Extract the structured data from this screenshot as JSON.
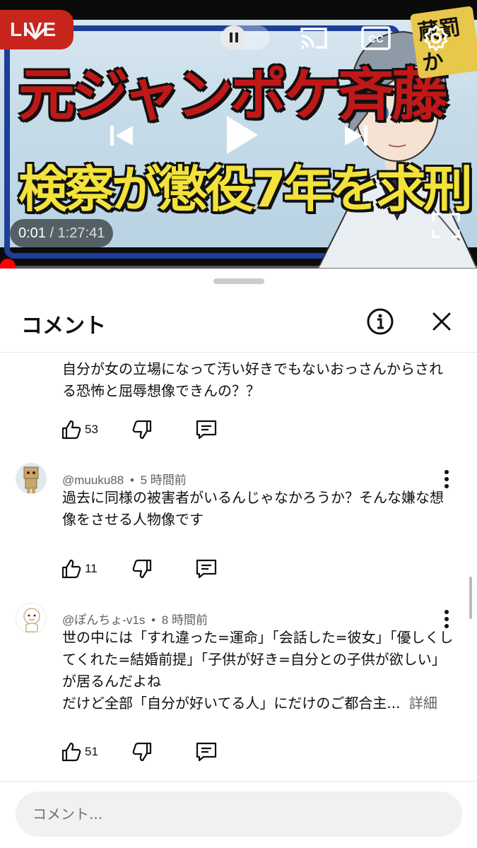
{
  "player": {
    "badge": "LIVE",
    "corner_tag": "蔵罰か",
    "title_line1": "元ジャンポケ斉藤",
    "title_line2": "検察が懲役7年を求刑",
    "time_current": "0:01",
    "time_separator": " / ",
    "time_total": "1:27:41",
    "progress": 0.0002,
    "icons": [
      "chevron-down-icon",
      "pause-icon",
      "cast-icon",
      "captions-icon",
      "settings-icon",
      "previous-icon",
      "play-icon",
      "next-icon",
      "fullscreen-icon"
    ],
    "colors": {
      "accent": "#ff0000",
      "live": "#c8261d"
    }
  },
  "sheet": {
    "title": "コメント",
    "input_placeholder": "コメント..."
  },
  "comments": [
    {
      "author": "",
      "time": "",
      "text": "自分が女の立場になって汚い好きでもないおっさんからされる恐怖と屈辱想像できんの？？",
      "more": "",
      "likes": "53"
    },
    {
      "author": "@muuku88",
      "dot": "•",
      "time": "5 時間前",
      "text": "過去に同様の被害者がいるんじゃなかろうか？そんな嫌な想像をさせる人物像です",
      "more": "",
      "likes": "11"
    },
    {
      "author": "@ぽんちょ-v1s",
      "dot": "•",
      "time": "8 時間前",
      "text_lines": [
        "世の中には「すれ違った=運命」「会話した=彼女」「優しくし",
        "てくれた=結婚前提」「子供が好き=自分との子供が欲しい」",
        "が居るんだよね",
        "だけど全部「自分が好いてる人」にだけのご都合主..."
      ],
      "more": "詳細",
      "likes": "51"
    }
  ]
}
